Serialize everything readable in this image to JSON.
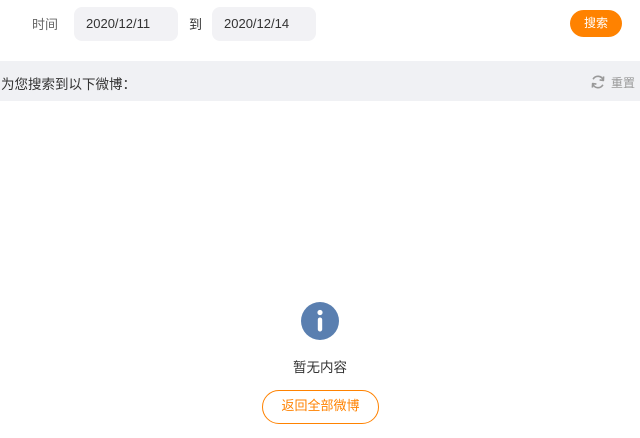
{
  "filter": {
    "time_label": "时间",
    "start_date": "2020/12/11",
    "to_label": "到",
    "end_date": "2020/12/14",
    "search_label": "搜索"
  },
  "results": {
    "title": "为您搜索到以下微博：",
    "reset_label": "重置"
  },
  "empty_state": {
    "icon": "info-icon",
    "message": "暂无内容",
    "back_label": "返回全部微博"
  },
  "colors": {
    "accent": "#ff8200",
    "info_icon": "#5a7fb0",
    "input_bg": "#f2f2f5",
    "header_bg": "#f0f1f4"
  }
}
